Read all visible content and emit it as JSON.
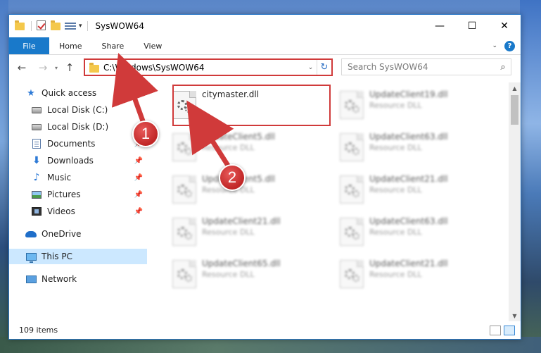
{
  "window": {
    "title": "SysWOW64",
    "minimize_glyph": "—",
    "maximize_glyph": "☐",
    "close_glyph": "✕"
  },
  "ribbon": {
    "tabs": [
      "File",
      "Home",
      "Share",
      "View"
    ]
  },
  "address": {
    "path": "C:\\Windows\\SysWOW64",
    "search_placeholder": "Search SysWOW64"
  },
  "sidebar": {
    "items": [
      {
        "label": "Quick access",
        "icon": "star-icon"
      },
      {
        "label": "Local Disk (C:)",
        "icon": "drive-icon"
      },
      {
        "label": "Local Disk (D:)",
        "icon": "drive-icon"
      },
      {
        "label": "Documents",
        "icon": "documents-icon"
      },
      {
        "label": "Downloads",
        "icon": "downloads-icon"
      },
      {
        "label": "Music",
        "icon": "music-icon"
      },
      {
        "label": "Pictures",
        "icon": "pictures-icon"
      },
      {
        "label": "Videos",
        "icon": "videos-icon"
      },
      {
        "label": "OneDrive",
        "icon": "onedrive-icon"
      },
      {
        "label": "This PC",
        "icon": "this-pc-icon"
      },
      {
        "label": "Network",
        "icon": "network-icon"
      }
    ]
  },
  "files": [
    {
      "name": "citymaster.dll",
      "type": ""
    },
    {
      "name": "UpdateClient19.dll",
      "type": "Resource DLL"
    },
    {
      "name": "UpdateClient5.dll",
      "type": "Resource DLL"
    },
    {
      "name": "UpdateClient63.dll",
      "type": "Resource DLL"
    },
    {
      "name": "UpdateClient5.dll",
      "type": "Resource DLL"
    },
    {
      "name": "UpdateClient21.dll",
      "type": "Resource DLL"
    },
    {
      "name": "UpdateClient21.dll",
      "type": "Resource DLL"
    },
    {
      "name": "UpdateClient63.dll",
      "type": "Resource DLL"
    },
    {
      "name": "UpdateClient65.dll",
      "type": "Resource DLL"
    },
    {
      "name": "UpdateClient21.dll",
      "type": "Resource DLL"
    }
  ],
  "status": {
    "item_count": "109 items"
  },
  "annotations": {
    "step1": "1",
    "step2": "2"
  },
  "colors": {
    "accent": "#1979ca",
    "annotation": "#d03a3a"
  }
}
